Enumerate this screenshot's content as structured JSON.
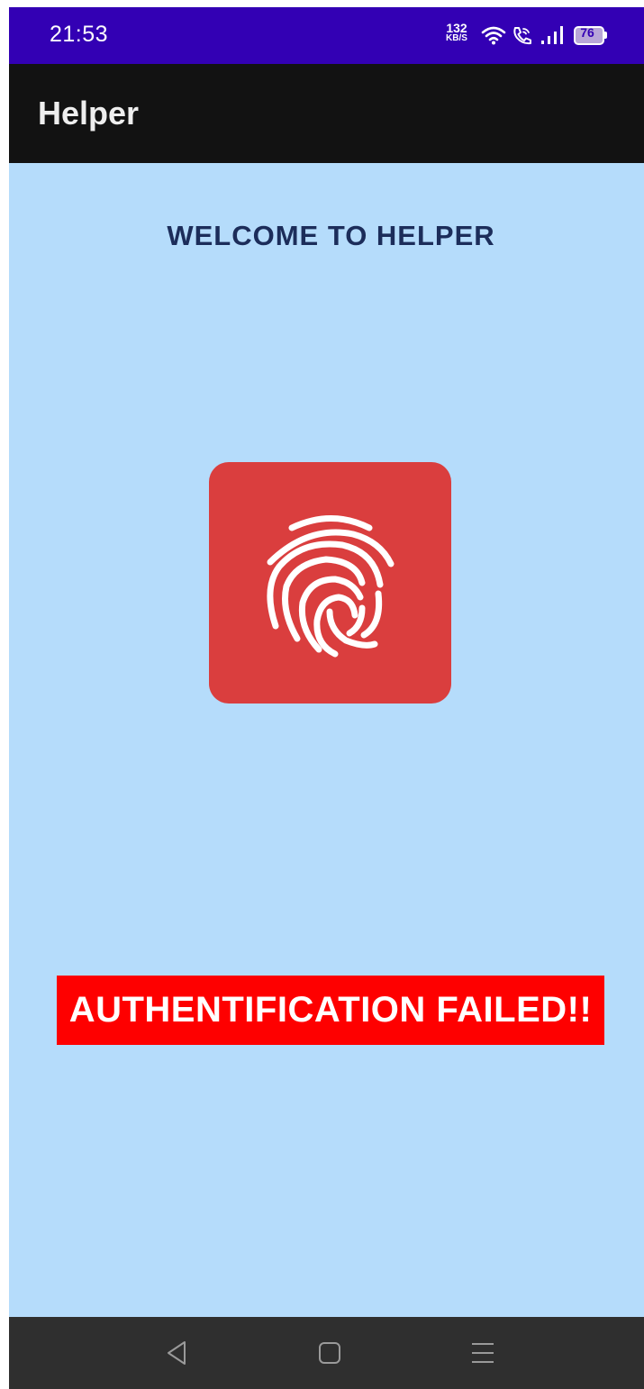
{
  "status_bar": {
    "time": "21:53",
    "net_speed_value": "132",
    "net_speed_unit": "KB/S",
    "battery_level": "76",
    "icons": [
      "wifi-icon",
      "wifi-call-icon",
      "signal-icon",
      "battery-icon"
    ]
  },
  "app_bar": {
    "title": "Helper"
  },
  "main": {
    "welcome_text": "WELCOME TO HELPER",
    "fingerprint_button_icon": "fingerprint-icon",
    "status_message": "AUTHENTIFICATION FAILED!!"
  },
  "nav_bar": {
    "icons": [
      "back-icon",
      "home-icon",
      "recents-icon"
    ]
  },
  "colors": {
    "status_bar": "#3300b4",
    "app_bar": "#121212",
    "background": "#b5dcfb",
    "welcome_text": "#1c2d5a",
    "fingerprint_button": "#da3e3e",
    "fail_banner": "#fe0000",
    "nav_bar": "#2f2f2f"
  }
}
